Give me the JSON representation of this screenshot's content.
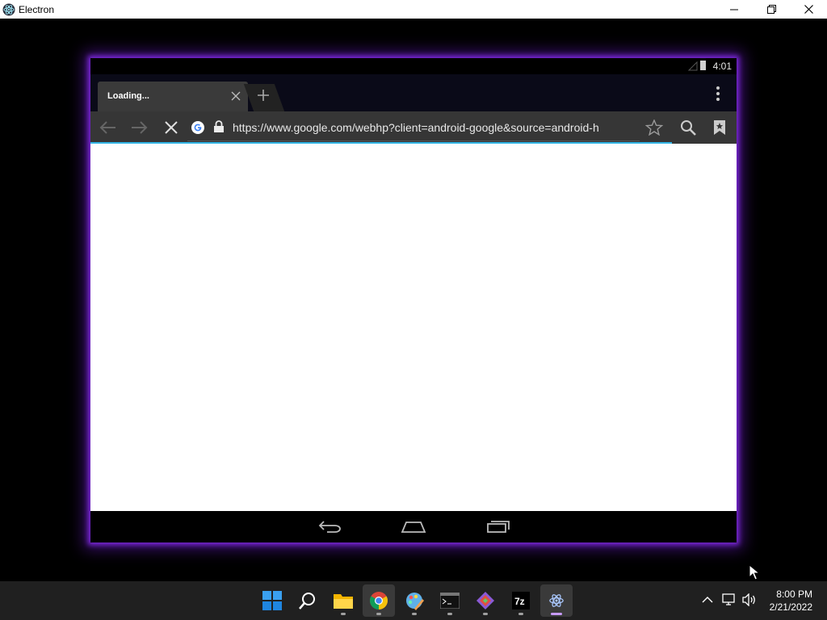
{
  "window": {
    "title": "Electron",
    "icon": "electron-icon"
  },
  "device": {
    "status_time": "4:01",
    "tab": {
      "label": "Loading..."
    },
    "url": "https://www.google.com/webhp?client=android-google&source=android-h",
    "load_progress": 0.9
  },
  "taskbar": {
    "apps": [
      "windows-start-icon",
      "search-icon",
      "file-explorer-icon",
      "chrome-icon",
      "paint-icon",
      "terminal-icon",
      "git-icon",
      "7zip-icon",
      "electron-icon"
    ],
    "time": "8:00 PM",
    "date": "2/21/2022"
  },
  "colors": {
    "accent_glow": "#7a28d8",
    "progress": "#33b5e5"
  }
}
